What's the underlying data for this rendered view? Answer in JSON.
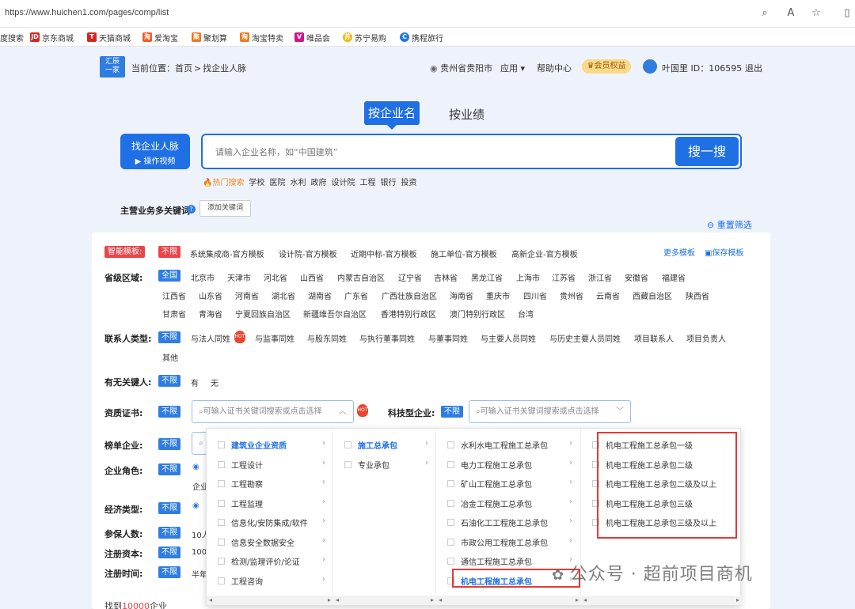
{
  "browser": {
    "url": "https://www.huichen1.com/pages/comp/list",
    "bookmarks": [
      {
        "label": "度搜索",
        "icon": "baidu-icon"
      },
      {
        "label": "京东商城",
        "icon": "jd-icon",
        "color": "#d7261f"
      },
      {
        "label": "天猫商城",
        "icon": "tmall-icon",
        "color": "#d7261f"
      },
      {
        "label": "爱淘宝",
        "icon": "aitaobao-icon",
        "color": "#f25a24"
      },
      {
        "label": "聚划算",
        "icon": "juhuasuan-icon",
        "color": "#f2771f"
      },
      {
        "label": "淘宝特卖",
        "icon": "taobao-icon",
        "color": "#f2771f"
      },
      {
        "label": "唯品会",
        "icon": "vip-icon",
        "color": "#d2148a"
      },
      {
        "label": "苏宁易购",
        "icon": "suning-icon",
        "color": "#f5b400"
      },
      {
        "label": "携程旅行",
        "icon": "ctrip-icon",
        "color": "#2577e3"
      }
    ]
  },
  "header": {
    "logo_text": "汇辰一家",
    "breadcrumb_prefix": "当前位置：",
    "breadcrumb_home": "首页",
    "breadcrumb_sep": ">",
    "breadcrumb_current": "找企业人脉",
    "location": "贵州省贵阳市",
    "apps": "应用",
    "help": "帮助中心",
    "vip": "会员权益",
    "user": "叶国里 ID：106595",
    "logout": "退出"
  },
  "search": {
    "tab_active": "按企业名",
    "tab_other": "按业绩",
    "find_title": "找企业人脉",
    "find_sub": "操作视频",
    "placeholder": "请输入企业名称，如“中国建筑”",
    "go": "搜一搜",
    "hot_label": "热门搜索",
    "hot": [
      "学校",
      "医院",
      "水利",
      "政府",
      "设计院",
      "工程",
      "银行",
      "投资"
    ]
  },
  "keywords": {
    "label": "主营业务多关键词",
    "add": "添加关键词"
  },
  "reset": "重置筛选",
  "filters": {
    "template_label": "智能模板:",
    "unlimited": "不限",
    "templates": [
      "系统集成商-官方模板",
      "设计院-官方模板",
      "近期中标-官方模板",
      "施工单位-官方模板",
      "高新企业-官方模板"
    ],
    "more_templates": "更多模板",
    "save_template": "保存模板",
    "region_label": "省级区域:",
    "all": "全国",
    "regions_row1": [
      "北京市",
      "天津市",
      "河北省",
      "山西省",
      "内蒙古自治区",
      "辽宁省",
      "吉林省",
      "黑龙江省",
      "上海市",
      "江苏省",
      "浙江省",
      "安徽省",
      "福建省"
    ],
    "regions_row2": [
      "江西省",
      "山东省",
      "河南省",
      "湖北省",
      "湖南省",
      "广东省",
      "广西壮族自治区",
      "海南省",
      "重庆市",
      "四川省",
      "贵州省",
      "云南省",
      "西藏自治区",
      "陕西省"
    ],
    "regions_row3": [
      "甘肃省",
      "青海省",
      "宁夏回族自治区",
      "新疆维吾尔自治区",
      "香港特别行政区",
      "澳门特别行政区",
      "台湾"
    ],
    "contact_label": "联系人类型:",
    "contacts": [
      "与法人同姓",
      "与监事同姓",
      "与股东同姓",
      "与执行董事同姓",
      "与董事同姓",
      "与主要人员同姓",
      "与历史主要人员同姓",
      "项目联系人",
      "项目负责人"
    ],
    "contact_other": "其他",
    "key_label": "有无关键人:",
    "key_yes": "有",
    "key_no": "无",
    "cert_label": "资质证书:",
    "cert_placeholder": "可输入证书关键词搜索或点击选择",
    "tech_label": "科技型企业:",
    "tech_placeholder": "可输入证书关键词搜索或点击选择",
    "rank_label": "榜单企业:",
    "role_label": "企业角色:",
    "role_partial": "企业",
    "econ_label": "经济类型:",
    "insured_label": "参保人数:",
    "insured_partial": "10人",
    "capital_label": "注册资本:",
    "capital_partial": "100",
    "regtime_label": "注册时间:",
    "regtime_partial": "半年"
  },
  "dropdown": {
    "col1": [
      "建筑业企业资质",
      "工程设计",
      "工程勘察",
      "工程监理",
      "信息化/安防集成/软件",
      "信息安全数据安全",
      "检测/监理评价/论证",
      "工程咨询"
    ],
    "col2": [
      "施工总承包",
      "专业承包"
    ],
    "col3": [
      "水利水电工程施工总承包",
      "电力工程施工总承包",
      "矿山工程施工总承包",
      "冶金工程施工总承包",
      "石油化工工程施工总承包",
      "市政公用工程施工总承包",
      "通信工程施工总承包",
      "机电工程施工总承包"
    ],
    "col4": [
      "机电工程施工总承包一级",
      "机电工程施工总承包二级",
      "机电工程施工总承包二级及以上",
      "机电工程施工总承包三级",
      "机电工程施工总承包三级及以上"
    ]
  },
  "result": {
    "prefix": "找到",
    "count": "10000",
    "suffix": "企业"
  },
  "watermark": "公众号 · 超前项目商机"
}
